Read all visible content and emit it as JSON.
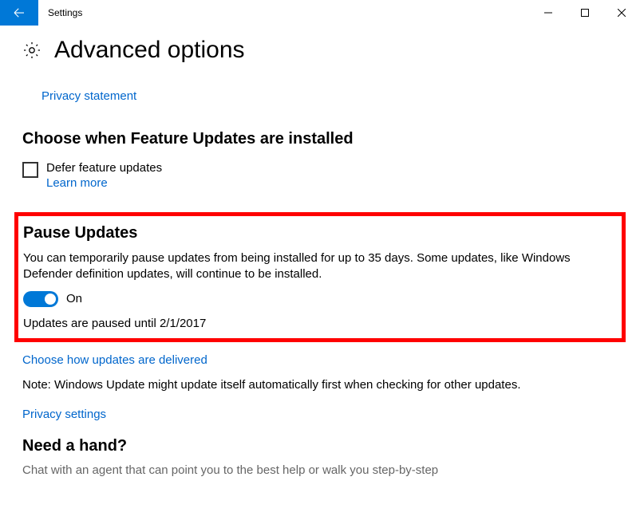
{
  "titlebar": {
    "app_name": "Settings"
  },
  "header": {
    "title": "Advanced options"
  },
  "links": {
    "privacy_statement": "Privacy statement",
    "learn_more": "Learn more",
    "choose_delivery": "Choose how updates are delivered",
    "privacy_settings": "Privacy settings"
  },
  "feature_updates": {
    "heading": "Choose when Feature Updates are installed",
    "checkbox_label": "Defer feature updates"
  },
  "pause": {
    "heading": "Pause Updates",
    "description": "You can temporarily pause updates from being installed for up to 35 days. Some updates, like Windows Defender definition updates, will continue to be installed.",
    "toggle_state": "On",
    "status": "Updates are paused until 2/1/2017"
  },
  "note": "Note: Windows Update might update itself automatically first when checking for other updates.",
  "help": {
    "heading": "Need a hand?",
    "chat": "Chat with an agent that can point you to the best help or walk you step-by-step"
  }
}
